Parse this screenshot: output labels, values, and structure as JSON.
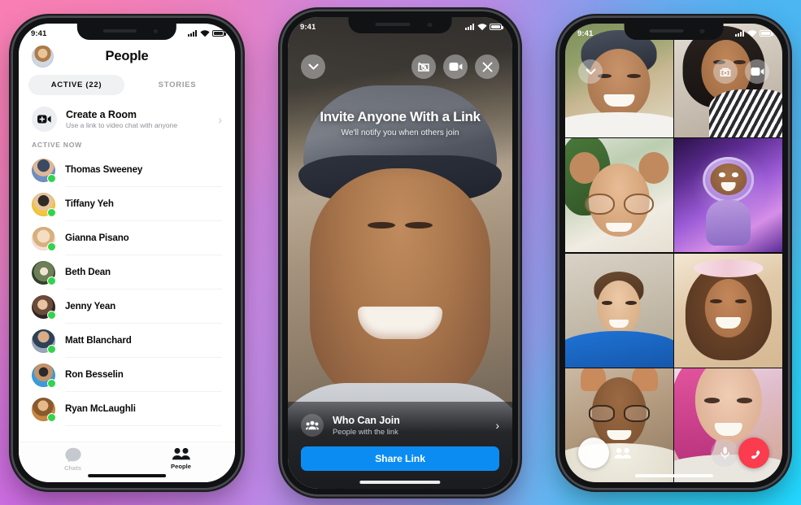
{
  "background": {
    "colors": [
      "#f279b2",
      "#c98ae6",
      "#a98fe8",
      "#55bdf0",
      "#2fd6ff"
    ]
  },
  "phones": {
    "people": {
      "status": {
        "time": "9:41",
        "signal_icon": "signal-bars-icon",
        "wifi_icon": "wifi-icon",
        "battery_icon": "battery-icon"
      },
      "avatar_name": "profile-avatar",
      "title": "People",
      "tabs": [
        {
          "label": "ACTIVE (22)",
          "active": true,
          "name": "tab-active"
        },
        {
          "label": "STORIES",
          "active": false,
          "name": "tab-stories"
        }
      ],
      "create_room": {
        "icon": "video-plus-icon",
        "title": "Create a Room",
        "subtitle": "Use a link to video chat with anyone",
        "chevron": "›"
      },
      "section_label": "ACTIVE NOW",
      "contacts": [
        {
          "name": "Thomas Sweeney"
        },
        {
          "name": "Tiffany Yeh"
        },
        {
          "name": "Gianna Pisano"
        },
        {
          "name": "Beth Dean"
        },
        {
          "name": "Jenny Yean"
        },
        {
          "name": "Matt Blanchard"
        },
        {
          "name": "Ron Besselin"
        },
        {
          "name": "Ryan McLaughli"
        }
      ],
      "tabbar": [
        {
          "label": "Chats",
          "icon": "chat-bubble-icon",
          "active": false,
          "name": "tabbar-chats"
        },
        {
          "label": "People",
          "icon": "people-icon",
          "active": true,
          "name": "tabbar-people"
        }
      ]
    },
    "room_invite": {
      "status": {
        "time": "9:41"
      },
      "controls": {
        "minimize_icon": "chevron-down-icon",
        "flip_camera_icon": "camera-flip-off-icon",
        "video_icon": "video-camera-icon",
        "close_icon": "close-x-icon"
      },
      "hero": {
        "title": "Invite Anyone With a Link",
        "subtitle": "We'll notify you when others join"
      },
      "who_can_join": {
        "icon": "people-group-icon",
        "title": "Who Can Join",
        "subtitle": "People with the link",
        "chevron": "›"
      },
      "share_button": {
        "label": "Share Link",
        "color": "#0b8cf2"
      }
    },
    "group_call": {
      "status": {
        "time": "9:41"
      },
      "controls": {
        "minimize_icon": "chevron-down-icon",
        "flip_camera_icon": "camera-flip-icon",
        "video_icon": "video-camera-icon",
        "effects_icon": "effects-circle-icon",
        "add_people_icon": "add-people-icon",
        "mic_icon": "microphone-icon",
        "end_call_icon": "end-call-icon",
        "end_call_color": "#fb3b4e"
      },
      "participant_count": 8,
      "tiles": [
        {
          "name": "participant-tile-1",
          "desc": "man in cap outdoors"
        },
        {
          "name": "participant-tile-2",
          "desc": "woman in striped top"
        },
        {
          "name": "participant-tile-3",
          "desc": "man with bear-ears filter and glasses"
        },
        {
          "name": "participant-tile-4",
          "desc": "astronaut avatar filter"
        },
        {
          "name": "participant-tile-5",
          "desc": "man in blue hoodie"
        },
        {
          "name": "participant-tile-6",
          "desc": "woman with flower crown filter"
        },
        {
          "name": "participant-tile-7",
          "desc": "woman with cat-ears filter"
        },
        {
          "name": "participant-tile-8",
          "desc": "woman with pink hair"
        }
      ]
    }
  }
}
